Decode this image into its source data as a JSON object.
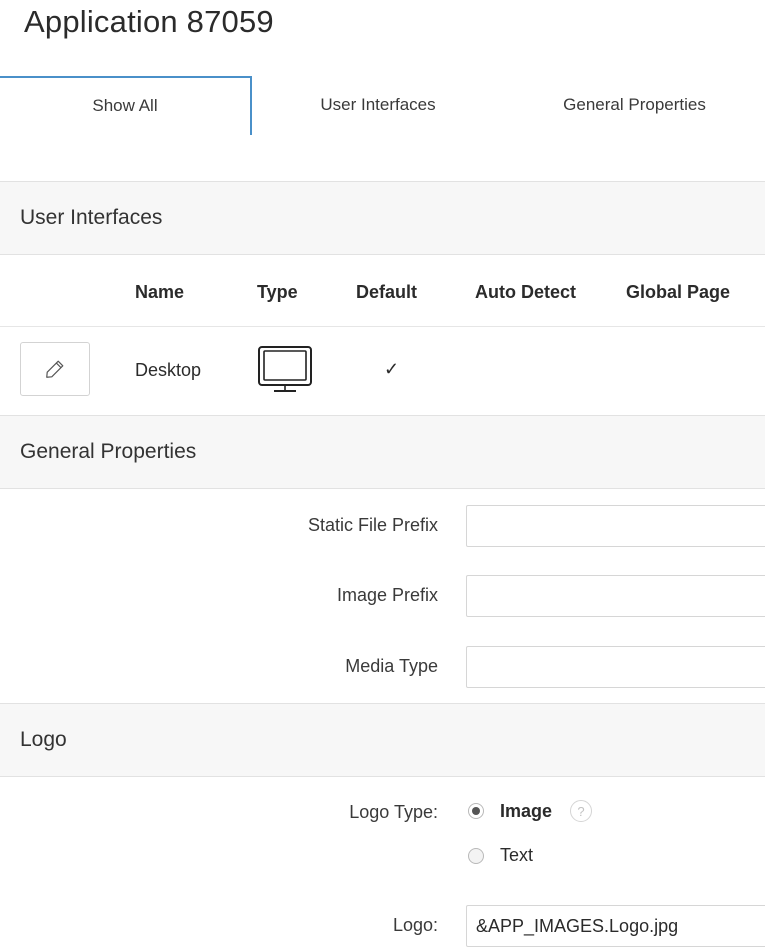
{
  "app_title": "Application 87059",
  "tabs": [
    {
      "label": "Show All",
      "active": true
    },
    {
      "label": "User Interfaces",
      "active": false
    },
    {
      "label": "General Properties",
      "active": false
    }
  ],
  "user_interfaces": {
    "heading": "User Interfaces",
    "columns": {
      "name": "Name",
      "type": "Type",
      "default": "Default",
      "auto_detect": "Auto Detect",
      "global_page": "Global Page"
    },
    "rows": [
      {
        "edit_icon": "pencil-icon",
        "name": "Desktop",
        "type_icon": "desktop-monitor-icon",
        "default": "✓",
        "auto_detect": "",
        "global_page": ""
      }
    ]
  },
  "general_properties": {
    "heading": "General Properties",
    "static_file_prefix": {
      "label": "Static File Prefix",
      "value": ""
    },
    "image_prefix": {
      "label": "Image Prefix",
      "value": ""
    },
    "media_type": {
      "label": "Media Type",
      "value": ""
    }
  },
  "logo": {
    "heading": "Logo",
    "logo_type_label": "Logo Type:",
    "options": [
      {
        "label": "Image",
        "checked": true
      },
      {
        "label": "Text",
        "checked": false
      }
    ],
    "help_icon": "help-icon",
    "help_glyph": "?",
    "logo_label": "Logo:",
    "logo_value": "&APP_IMAGES.Logo.jpg"
  },
  "colors": {
    "accent": "#4a90c9",
    "section_bg": "#f7f7f7",
    "border": "#e2e2e2"
  }
}
